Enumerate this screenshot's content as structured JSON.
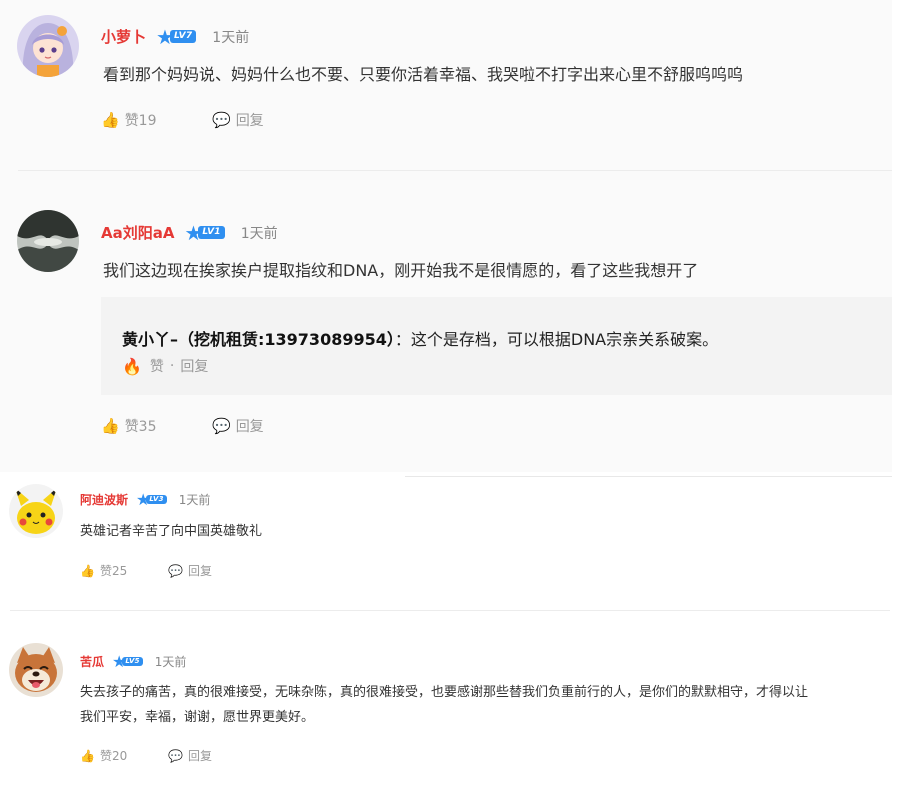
{
  "comments": [
    {
      "username": "小萝卜",
      "level": "LV7",
      "time": "1天前",
      "text": "看到那个妈妈说、妈妈什么也不要、只要你活着幸福、我哭啦不打字出来心里不舒服呜呜呜",
      "like_label": "赞19",
      "reply_label": "回复",
      "avatar_icon": "anime-girl-avatar"
    },
    {
      "username": "Aa刘阳aA",
      "level": "LV1",
      "time": "1天前",
      "text": "我们这边现在挨家挨户提取指纹和DNA，刚开始我不是很情愿的，看了这些我想开了",
      "like_label": "赞35",
      "reply_label": "回复",
      "avatar_icon": "landscape-avatar",
      "reply": {
        "author": "黄小丫–（挖机租赁:13973089954）",
        "separator": "：",
        "text": "这个是存档，可以根据DNA宗亲关系破案。",
        "like_label": "赞",
        "dot": "·",
        "reply_label": "回复"
      }
    },
    {
      "username": "阿迪波斯",
      "level": "LV3",
      "time": "1天前",
      "text": "英雄记者辛苦了向中国英雄敬礼",
      "like_label": "赞25",
      "reply_label": "回复",
      "avatar_icon": "pikachu-avatar"
    },
    {
      "username": "苦瓜",
      "level": "LV5",
      "time": "1天前",
      "text_line1": "失去孩子的痛苦，真的很难接受，无味杂陈，真的很难接受，也要感谢那些替我们负重前行的人，是你们的默默相守，才得以让",
      "text_line2": "我们平安，幸福，谢谢，愿世界更美好。",
      "like_label": "赞20",
      "reply_label": "回复",
      "avatar_icon": "shiba-dog-avatar"
    }
  ],
  "colors": {
    "username": "#e53935",
    "level_badge": "#2f8ff0",
    "muted": "#999999",
    "flame": "#ff5a1f"
  }
}
